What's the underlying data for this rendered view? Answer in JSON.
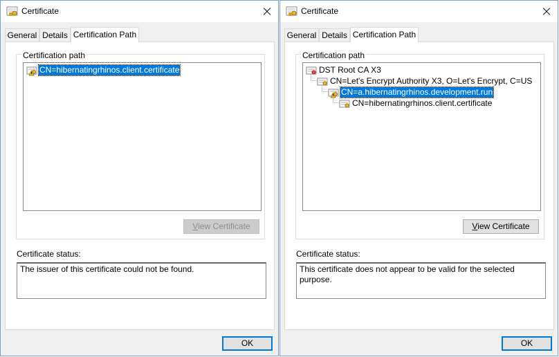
{
  "dialogs": [
    {
      "title": "Certificate",
      "tabs": [
        "General",
        "Details",
        "Certification Path"
      ],
      "group_label": "Certification path",
      "tree": [
        {
          "label": "CN=hibernatingrhinos.client.certificate",
          "level": 0,
          "icon": "certificate-warning-icon",
          "selected": true
        }
      ],
      "view_button": "View Certificate",
      "view_button_enabled": false,
      "status_label": "Certificate status:",
      "status_text": "The issuer of this certificate could not be found.",
      "ok_label": "OK"
    },
    {
      "title": "Certificate",
      "tabs": [
        "General",
        "Details",
        "Certification Path"
      ],
      "group_label": "Certification path",
      "tree": [
        {
          "label": "DST Root CA X3",
          "level": 0,
          "icon": "certificate-icon",
          "selected": false
        },
        {
          "label": "CN=Let's Encrypt Authority X3, O=Let's Encrypt, C=US",
          "level": 1,
          "icon": "certificate-icon",
          "selected": false
        },
        {
          "label": "CN=a.hibernatingrhinos.development.run",
          "level": 2,
          "icon": "certificate-warning-icon",
          "selected": true
        },
        {
          "label": "CN=hibernatingrhinos.client.certificate",
          "level": 3,
          "icon": "certificate-icon",
          "selected": false
        }
      ],
      "view_button": "View Certificate",
      "view_button_enabled": true,
      "status_label": "Certificate status:",
      "status_text": "This certificate does not appear to be valid for the selected purpose.",
      "ok_label": "OK"
    }
  ]
}
